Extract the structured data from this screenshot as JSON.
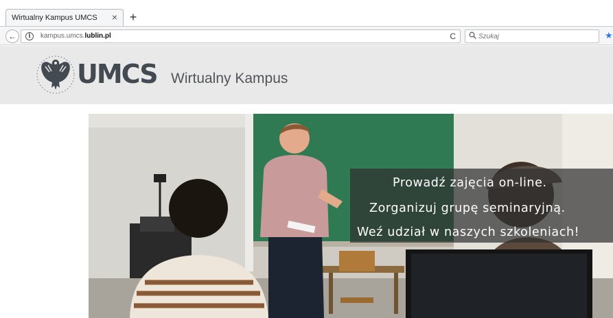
{
  "browser": {
    "tab_title": "Wirtualny Kampus UMCS",
    "tab_close": "×",
    "new_tab": "+",
    "back": "←",
    "info": "i",
    "url_host": "kampus.umcs.",
    "url_domain": "lublin.pl",
    "reload": "C",
    "search_icon": "⚲",
    "search_placeholder": "Szukaj",
    "star": "★"
  },
  "site": {
    "logo_text": "UMCS",
    "title": "Wirtualny Kampus"
  },
  "hero": {
    "lines": [
      "Prowadź zajęcia on-line.",
      "Zorganizuj grupę seminaryjną.",
      "Weź udział w naszych szkoleniach!"
    ]
  },
  "colors": {
    "chrome_bg": "#f5f6f7",
    "header_bg": "#e9e9e9",
    "logo": "#444a52",
    "caption_bg": "#303030",
    "star": "#2f78e8"
  },
  "icons": [
    "back-arrow-icon",
    "info-icon",
    "reload-icon",
    "search-icon",
    "bookmark-star-icon",
    "eagle-emblem-icon",
    "close-icon",
    "plus-icon"
  ]
}
